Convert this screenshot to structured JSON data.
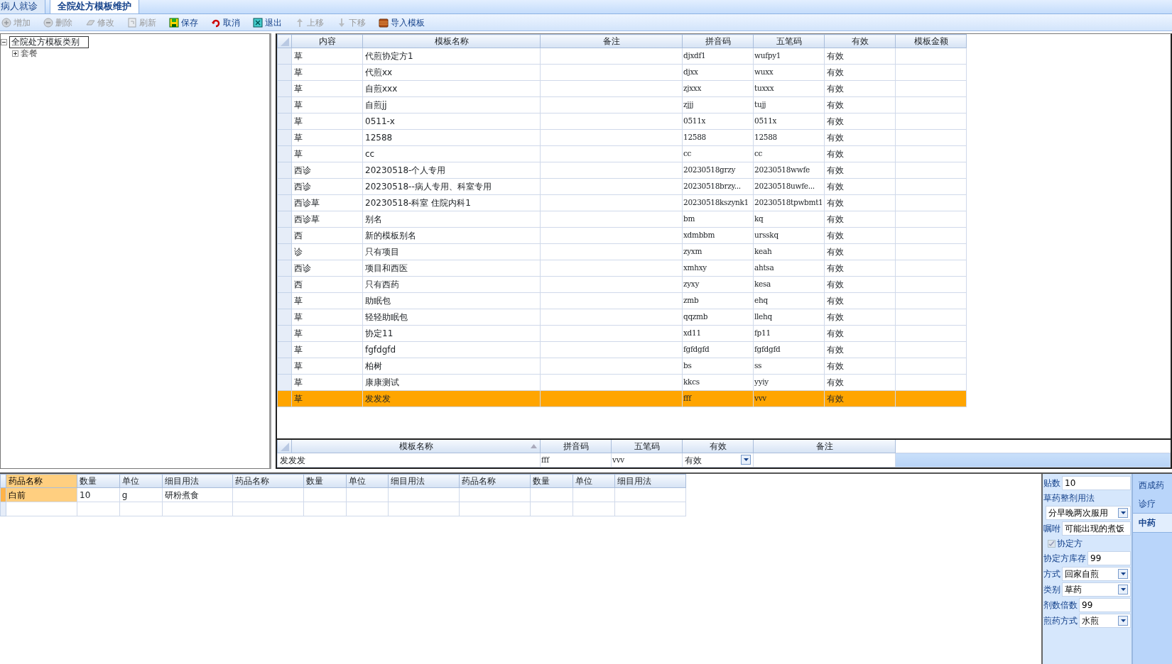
{
  "tabs": [
    {
      "label": "病人就诊",
      "selected": false
    },
    {
      "label": "全院处方模板维护",
      "selected": true
    }
  ],
  "toolbar": [
    {
      "label": "增加",
      "disabled": true
    },
    {
      "label": "删除",
      "disabled": true
    },
    {
      "label": "修改",
      "disabled": true
    },
    {
      "label": "刷新",
      "disabled": true
    },
    {
      "label": "保存",
      "disabled": false
    },
    {
      "label": "取消",
      "disabled": false
    },
    {
      "label": "退出",
      "disabled": false
    },
    {
      "label": "上移",
      "disabled": true
    },
    {
      "label": "下移",
      "disabled": true
    },
    {
      "label": "导入模板",
      "disabled": false
    }
  ],
  "tree": {
    "label": "全院处方模板类别",
    "expanded": true,
    "children": [
      {
        "label": "套餐",
        "expanded": false
      }
    ]
  },
  "grid": {
    "columns": [
      "内容",
      "模板名称",
      "备注",
      "拼音码",
      "五笔码",
      "有效",
      "模板金额"
    ],
    "rows": [
      {
        "cells": [
          "草",
          "代煎协定方1",
          "",
          "djxdf1",
          "wufpy1",
          "有效",
          ""
        ],
        "selected": false
      },
      {
        "cells": [
          "草",
          "代煎xx",
          "",
          "djxx",
          "wuxx",
          "有效",
          ""
        ],
        "selected": false
      },
      {
        "cells": [
          "草",
          "自煎xxx",
          "",
          "zjxxx",
          "tuxxx",
          "有效",
          ""
        ],
        "selected": false
      },
      {
        "cells": [
          "草",
          "自煎jj",
          "",
          "zjjj",
          "tujj",
          "有效",
          ""
        ],
        "selected": false
      },
      {
        "cells": [
          "草",
          "0511-x",
          "",
          "0511x",
          "0511x",
          "有效",
          ""
        ],
        "selected": false
      },
      {
        "cells": [
          "草",
          "12588",
          "",
          "12588",
          "12588",
          "有效",
          ""
        ],
        "selected": false
      },
      {
        "cells": [
          "草",
          "cc",
          "",
          "cc",
          "cc",
          "有效",
          ""
        ],
        "selected": false
      },
      {
        "cells": [
          "西诊",
          "20230518-个人专用",
          "",
          "20230518grzy",
          "20230518wwfe",
          "有效",
          ""
        ],
        "selected": false
      },
      {
        "cells": [
          "西诊",
          "20230518--病人专用、科室专用",
          "",
          "20230518brzy...",
          "20230518uwfe...",
          "有效",
          ""
        ],
        "selected": false
      },
      {
        "cells": [
          "西诊草",
          "20230518-科室 住院内科1",
          "",
          "20230518kszynk1",
          "20230518tpwbmt1",
          "有效",
          ""
        ],
        "selected": false
      },
      {
        "cells": [
          "西诊草",
          "别名",
          "",
          "bm",
          "kq",
          "有效",
          ""
        ],
        "selected": false
      },
      {
        "cells": [
          "西",
          "新的模板别名",
          "",
          "xdmbbm",
          "ursskq",
          "有效",
          ""
        ],
        "selected": false
      },
      {
        "cells": [
          "诊",
          "只有项目",
          "",
          "zyxm",
          "keah",
          "有效",
          ""
        ],
        "selected": false
      },
      {
        "cells": [
          "西诊",
          "项目和西医",
          "",
          "xmhxy",
          "ahtsa",
          "有效",
          ""
        ],
        "selected": false
      },
      {
        "cells": [
          "西",
          "只有西药",
          "",
          "zyxy",
          "kesa",
          "有效",
          ""
        ],
        "selected": false
      },
      {
        "cells": [
          "草",
          "助眠包",
          "",
          "zmb",
          "ehq",
          "有效",
          ""
        ],
        "selected": false
      },
      {
        "cells": [
          "草",
          "轻轻助眠包",
          "",
          "qqzmb",
          "llehq",
          "有效",
          ""
        ],
        "selected": false
      },
      {
        "cells": [
          "草",
          "协定11",
          "",
          "xd11",
          "fp11",
          "有效",
          ""
        ],
        "selected": false
      },
      {
        "cells": [
          "草",
          "fgfdgfd",
          "",
          "fgfdgfd",
          "fgfdgfd",
          "有效",
          ""
        ],
        "selected": false
      },
      {
        "cells": [
          "草",
          "柏树",
          "",
          "bs",
          "ss",
          "有效",
          ""
        ],
        "selected": false
      },
      {
        "cells": [
          "草",
          "康康测试",
          "",
          "kkcs",
          "yyiy",
          "有效",
          ""
        ],
        "selected": false
      },
      {
        "cells": [
          "草",
          "发发发",
          "",
          "fff",
          "vvv",
          "有效",
          ""
        ],
        "selected": true
      }
    ]
  },
  "edit_grid": {
    "columns": [
      {
        "label": "模板名称",
        "sorted": true
      },
      {
        "label": "拼音码",
        "sorted": false
      },
      {
        "label": "五笔码",
        "sorted": false
      },
      {
        "label": "有效",
        "sorted": false
      },
      {
        "label": "备注",
        "sorted": false
      }
    ],
    "row": [
      {
        "kind": "text",
        "value": "发发发"
      },
      {
        "kind": "text",
        "value": "fff"
      },
      {
        "kind": "text",
        "value": "vvv"
      },
      {
        "kind": "dropdown",
        "value": "有效"
      },
      {
        "kind": "text"
      }
    ]
  },
  "drug_grid": {
    "columns": [
      "药品名称",
      "数量",
      "单位",
      "细目用法",
      "药品名称",
      "数量",
      "单位",
      "细目用法",
      "药品名称",
      "数量",
      "单位",
      "细目用法"
    ],
    "rows": [
      {
        "cells": [
          "白前",
          "10",
          "g",
          "研粉煮食",
          "",
          "",
          "",
          "",
          "",
          "",
          "",
          ""
        ],
        "active": true
      },
      {
        "cells": [
          "",
          "",
          "",
          "",
          "",
          "",
          "",
          "",
          "",
          "",
          "",
          ""
        ],
        "active": false
      }
    ]
  },
  "form": [
    {
      "kind": "text",
      "label": "贴数",
      "value": "10"
    },
    {
      "kind": "caption",
      "label": "草药整剂用法"
    },
    {
      "kind": "dropdown",
      "value": "分早晚两次服用"
    },
    {
      "kind": "text",
      "label": "嘱咐",
      "value": "可能出现的煮饭"
    },
    {
      "kind": "checkbox",
      "label": "协定方",
      "checked": true,
      "disabled": true
    },
    {
      "kind": "text",
      "label": "协定方库存",
      "value": "99"
    },
    {
      "kind": "dropdown",
      "label": "方式",
      "value": "回家自煎"
    },
    {
      "kind": "dropdown",
      "label": "类别",
      "value": "草药"
    },
    {
      "kind": "text",
      "label": "剂数倍数",
      "value": "99"
    },
    {
      "kind": "dropdown",
      "label": "煎药方式",
      "value": "水煎"
    }
  ],
  "side_tabs": [
    {
      "label": "西成药",
      "selected": false
    },
    {
      "label": "诊疗",
      "selected": false
    },
    {
      "label": "中药",
      "selected": true
    }
  ]
}
